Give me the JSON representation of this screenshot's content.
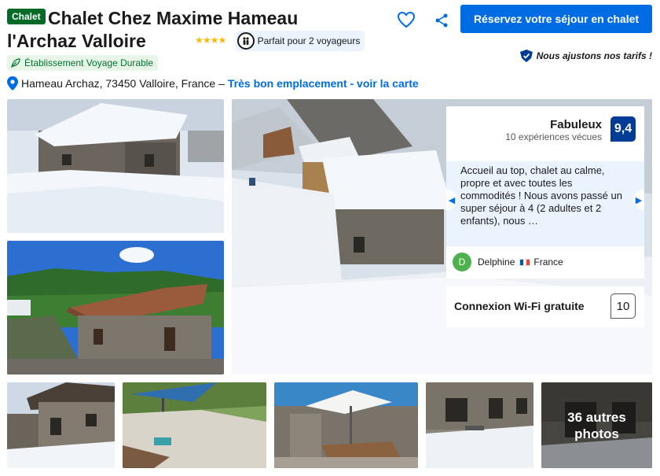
{
  "header": {
    "property_type": "Chalet",
    "title": "Chalet Chez Maxime Hameau l'Archaz Valloire",
    "stars_glyph": "★★★★",
    "traveler_chip": "Parfait pour 2 voyageurs",
    "sustainability_badge": "Établissement Voyage Durable",
    "address": "Hameau Archaz, 73450 Valloire, France –",
    "location_link": "Très bon emplacement - voir la carte"
  },
  "actions": {
    "book_button": "Réservez votre séjour en chalet",
    "price_match": "Nous ajustons nos tarifs !"
  },
  "review_panel": {
    "score_word": "Fabuleux",
    "score_count": "10 expériences vécues",
    "score": "9,4",
    "review_text": "Accueil au top, chalet au calme, propre et avec toutes les commodités ! Nous avons passé un super séjour à 4 (2 adultes et 2 enfants), nous …",
    "reviewer_initial": "D",
    "reviewer_name": "Delphine",
    "reviewer_country": "France"
  },
  "facility_score": {
    "label": "Connexion Wi-Fi gratuite",
    "score": "10"
  },
  "gallery": {
    "more_photos": "36 autres photos"
  },
  "colors": {
    "brand_blue": "#006ce4",
    "score_navy": "#003b95",
    "star_yellow": "#febb02",
    "badge_green": "#006a26"
  }
}
